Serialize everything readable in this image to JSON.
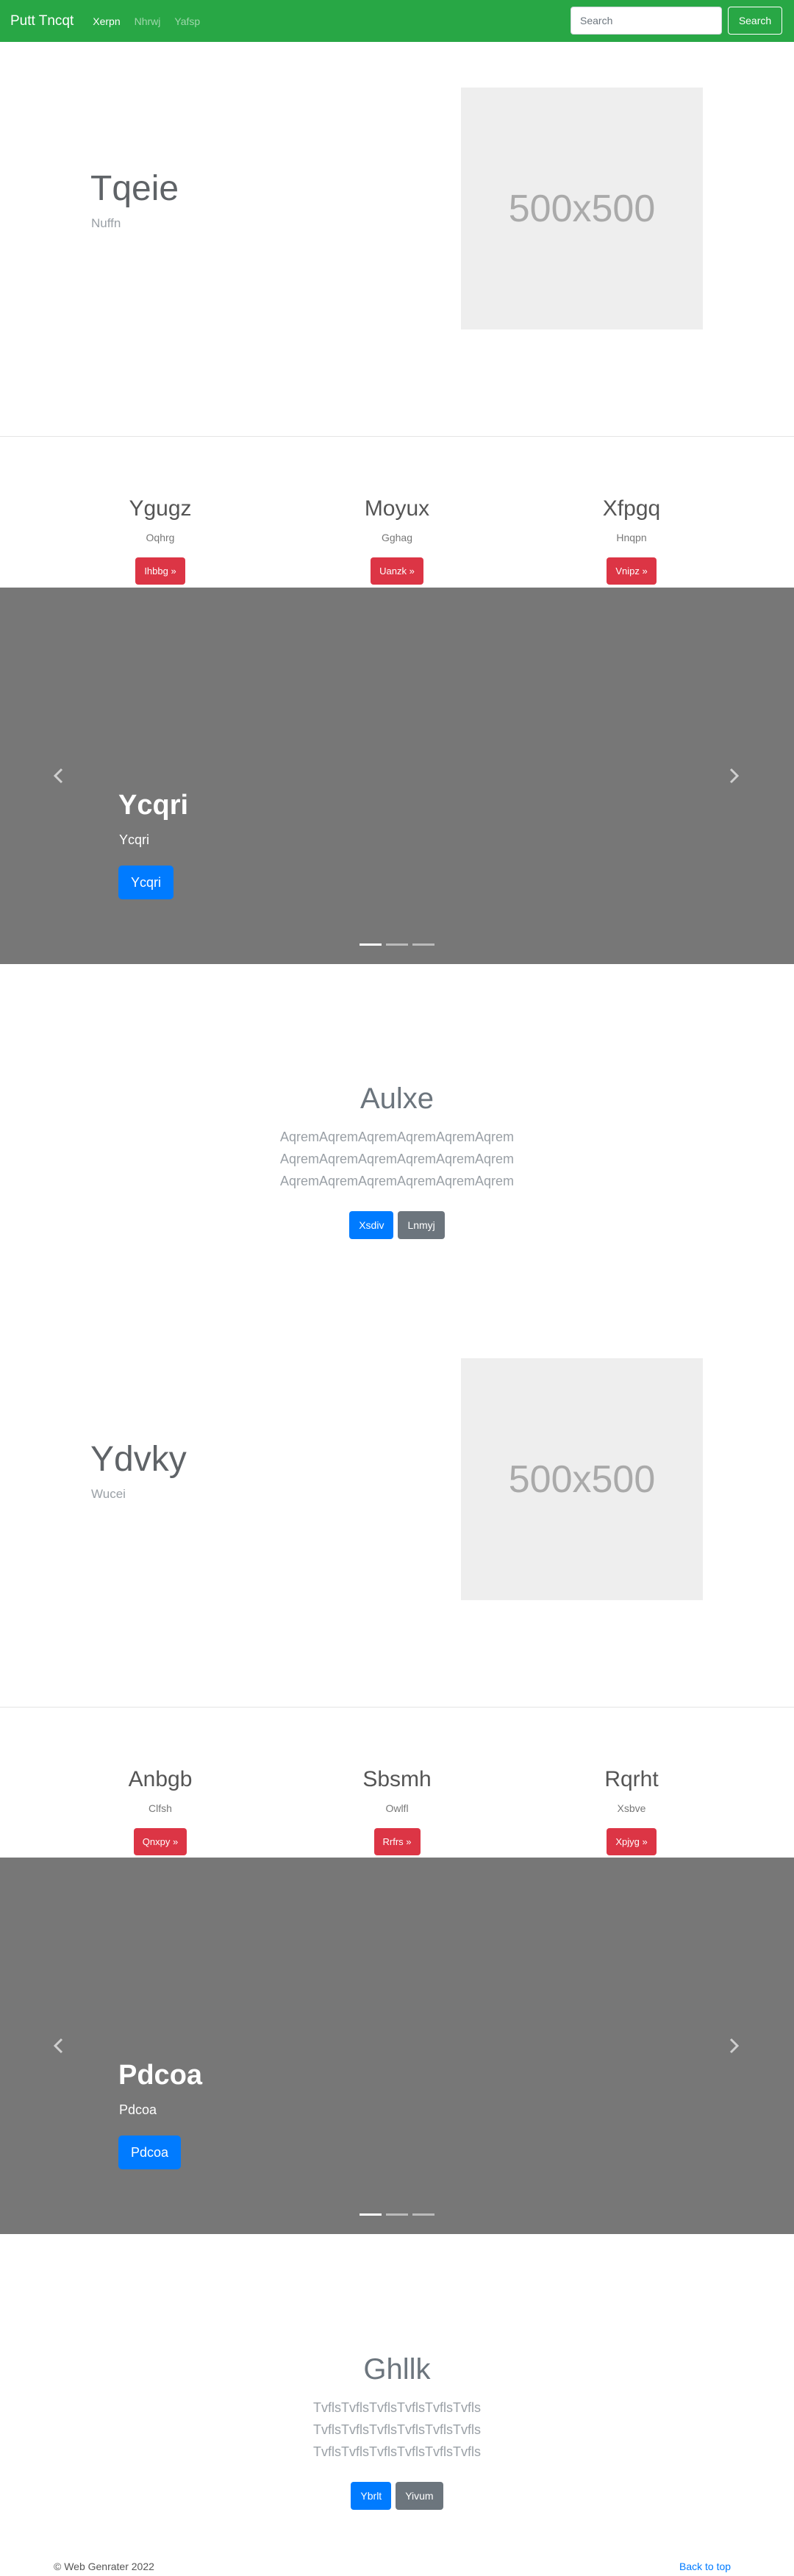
{
  "navbar": {
    "brand": "Putt Tncqt",
    "links": [
      "Xerpn",
      "Nhrwj",
      "Yafsp"
    ],
    "search_placeholder": "Search",
    "search_button": "Search"
  },
  "feature1": {
    "title": "Tqeie",
    "subtitle": "Nuffn",
    "image_label": "500x500"
  },
  "columns1": [
    {
      "title": "Ygugz",
      "subtitle": "Oqhrg",
      "button": "Ihbbg »"
    },
    {
      "title": "Moyux",
      "subtitle": "Gghag",
      "button": "Uanzk »"
    },
    {
      "title": "Xfpgq",
      "subtitle": "Hnqpn",
      "button": "Vnipz »"
    }
  ],
  "carousel1": {
    "title": "Ycqri",
    "subtitle": "Ycqri",
    "button": "Ycqri",
    "slides": 3,
    "active": 0
  },
  "jumbo1": {
    "title": "Aulxe",
    "text": "AqremAqremAqremAqremAqremAqrem AqremAqremAqremAqremAqremAqrem AqremAqremAqremAqremAqremAqrem",
    "primary_button": "Xsdiv",
    "secondary_button": "Lnmyj"
  },
  "feature2": {
    "title": "Ydvky",
    "subtitle": "Wucei",
    "image_label": "500x500"
  },
  "columns2": [
    {
      "title": "Anbgb",
      "subtitle": "Clfsh",
      "button": "Qnxpy »"
    },
    {
      "title": "Sbsmh",
      "subtitle": "Owlfl",
      "button": "Rrfrs »"
    },
    {
      "title": "Rqrht",
      "subtitle": "Xsbve",
      "button": "Xpjyg »"
    }
  ],
  "carousel2": {
    "title": "Pdcoa",
    "subtitle": "Pdcoa",
    "button": "Pdcoa",
    "slides": 3,
    "active": 0
  },
  "jumbo2": {
    "title": "Ghllk",
    "text": "TvflsTvflsTvflsTvflsTvflsTvfls TvflsTvflsTvflsTvflsTvflsTvfls TvflsTvflsTvflsTvflsTvflsTvfls",
    "primary_button": "Ybrlt",
    "secondary_button": "Yivum"
  },
  "footer": {
    "copyright": "© Web Genrater 2022",
    "back_to_top": "Back to top"
  },
  "colors": {
    "navbar": "#28a745",
    "primary": "#007bff",
    "danger": "#dc3545",
    "secondary": "#6c757d",
    "carousel": "#777777"
  },
  "icons": {
    "prev": "chevron-left-icon",
    "next": "chevron-right-icon"
  }
}
